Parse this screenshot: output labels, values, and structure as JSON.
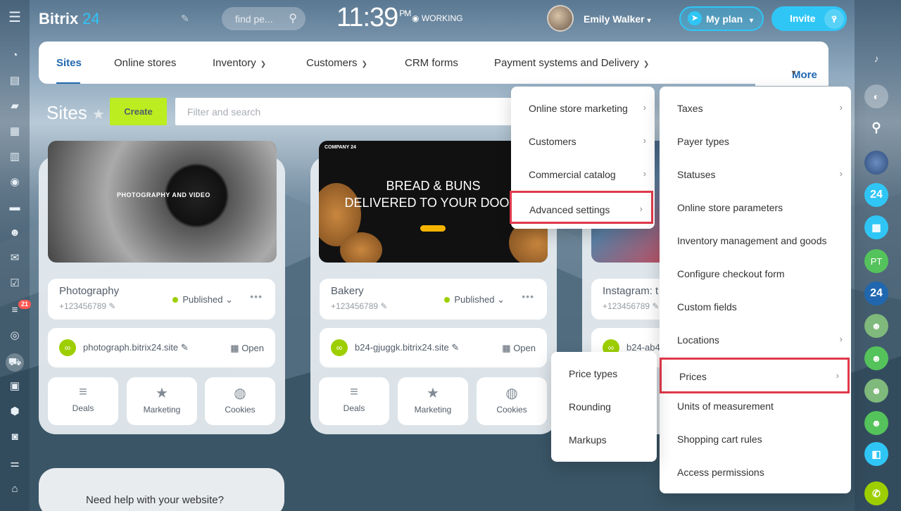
{
  "topbar": {
    "logo_text": "Bitrix",
    "logo_num": "24",
    "search_placeholder": "find pe...",
    "time": "11:39",
    "ampm": "PM",
    "working": "WORKING",
    "user_name": "Emily Walker",
    "myplan": "My plan",
    "invite": "Invite"
  },
  "leftbar": {
    "badge": "21"
  },
  "nav": {
    "items": [
      "Sites",
      "Online stores",
      "Inventory",
      "Customers",
      "CRM forms",
      "Payment systems and Delivery"
    ],
    "more": "More"
  },
  "page": {
    "title": "Sites",
    "create": "Create",
    "filter_placeholder": "Filter and search"
  },
  "cards": [
    {
      "thumb_title": "PHOTOGRAPHY AND VIDEO",
      "name": "Photography",
      "phone": "+123456789",
      "status": "Published",
      "url": "photograph.bitrix24.site",
      "open": "Open"
    },
    {
      "thumb_company": "COMPANY 24",
      "thumb_title_1": "BREAD & BUNS",
      "thumb_title_2": "DELIVERED TO YOUR DOOR!",
      "name": "Bakery",
      "phone": "+123456789",
      "status": "Published",
      "url": "b24-gjuggk.bitrix24.site",
      "open": "Open"
    },
    {
      "name": "Instagram: t",
      "phone": "+123456789",
      "url": "b24-ab4"
    }
  ],
  "tiles": [
    "Deals",
    "Marketing",
    "Cookies"
  ],
  "help_card": "Need help with your website?",
  "menu1": [
    "Online store marketing",
    "Customers",
    "Commercial catalog",
    "Advanced settings"
  ],
  "menu2": [
    "Taxes",
    "Payer types",
    "Statuses",
    "Online store parameters",
    "Inventory management and goods",
    "Configure checkout form",
    "Custom fields",
    "Locations",
    "Prices",
    "Units of measurement",
    "Shopping cart rules",
    "Access permissions"
  ],
  "menu3": [
    "Price types",
    "Rounding",
    "Markups"
  ],
  "rightbar": {
    "pt": "PT",
    "b24": "24"
  },
  "colors": {
    "accent": "#2fc6f6",
    "create": "#bbed21",
    "highlight": "#e0394a",
    "published": "#9dcf00"
  }
}
